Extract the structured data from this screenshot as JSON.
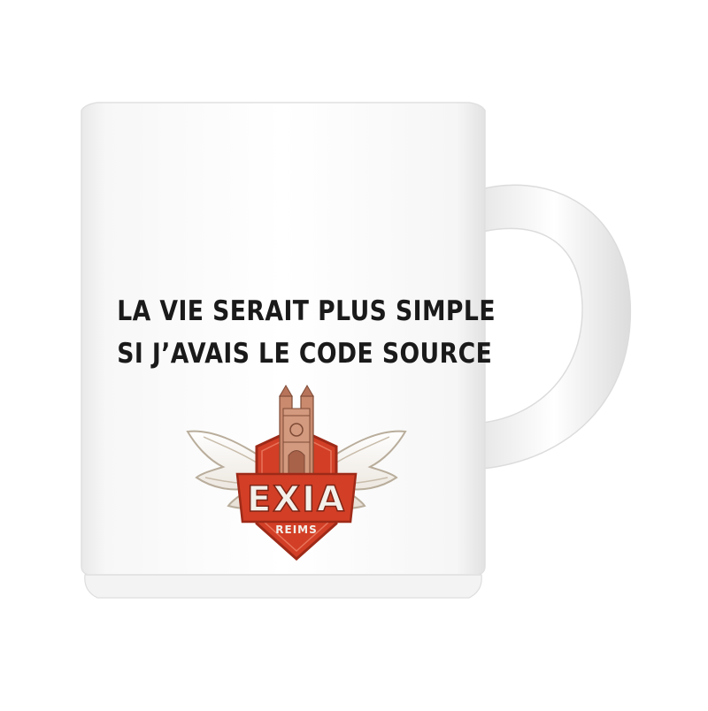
{
  "mug": {
    "slogan_line1": "LA VIE SERAIT PLUS SIMPLE",
    "slogan_line2": "SI J’AVAIS LE CODE SOURCE",
    "logo": {
      "wordmark": "EXIA",
      "city": "REIMS"
    },
    "colors": {
      "logo_red": "#d23f26",
      "logo_dark_red": "#9e2a18",
      "building": "#c98a6e",
      "text": "#1a1a1a"
    }
  }
}
